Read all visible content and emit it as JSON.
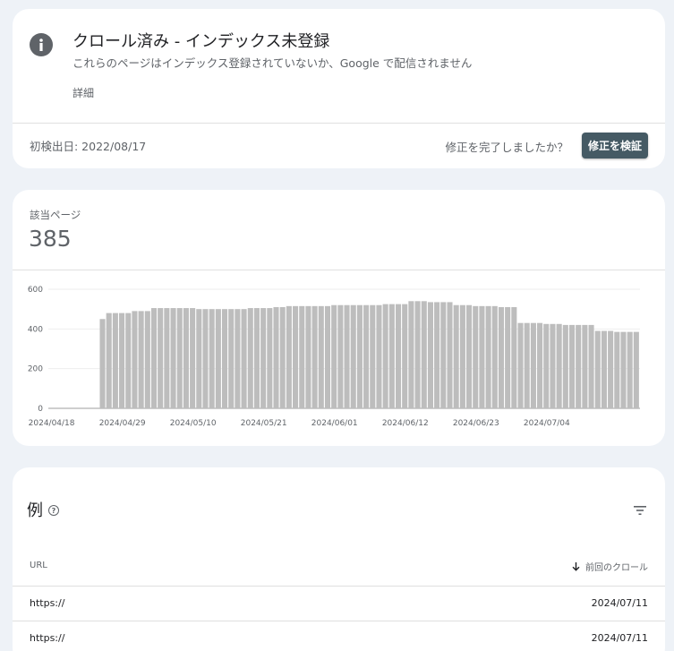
{
  "issue": {
    "title": "クロール済み - インデックス未登録",
    "description": "これらのページはインデックス登録されていないか、Google で配信されません",
    "details_link": "詳細",
    "first_detected": "初検出日: 2022/08/17",
    "fix_question": "修正を完了しましたか？",
    "validate_button": "修正を検証",
    "icon": "info-icon"
  },
  "affected": {
    "label": "該当ページ",
    "count": "385"
  },
  "chart_data": {
    "type": "bar",
    "y_ticks": [
      "600",
      "400",
      "200",
      "0"
    ],
    "ylim": [
      0,
      600
    ],
    "x_tick_labels": [
      "2024/04/18",
      "2024/04/29",
      "2024/05/10",
      "2024/05/21",
      "2024/06/01",
      "2024/06/12",
      "2024/06/23",
      "2024/07/04"
    ],
    "start_date": "2024/04/18",
    "values": [
      0,
      0,
      0,
      0,
      0,
      0,
      0,
      0,
      450,
      480,
      480,
      480,
      480,
      490,
      490,
      490,
      505,
      505,
      505,
      505,
      505,
      505,
      505,
      500,
      500,
      500,
      500,
      500,
      500,
      500,
      500,
      505,
      505,
      505,
      505,
      510,
      510,
      515,
      515,
      515,
      515,
      515,
      515,
      515,
      520,
      520,
      520,
      520,
      520,
      520,
      520,
      520,
      525,
      525,
      525,
      525,
      540,
      540,
      540,
      535,
      535,
      535,
      535,
      520,
      520,
      520,
      515,
      515,
      515,
      515,
      510,
      510,
      510,
      430,
      430,
      430,
      430,
      425,
      425,
      425,
      420,
      420,
      420,
      420,
      420,
      390,
      390,
      390,
      385,
      385,
      385,
      385
    ],
    "bar_color": "#bdbdbd"
  },
  "examples": {
    "title": "例",
    "help_icon": "help-icon",
    "filter_icon": "filter-icon",
    "columns": {
      "url": "URL",
      "last_crawl": "前回のクロール"
    },
    "rows": [
      {
        "url": "https://",
        "date": "2024/07/11"
      },
      {
        "url": "https://",
        "date": "2024/07/11"
      }
    ]
  }
}
